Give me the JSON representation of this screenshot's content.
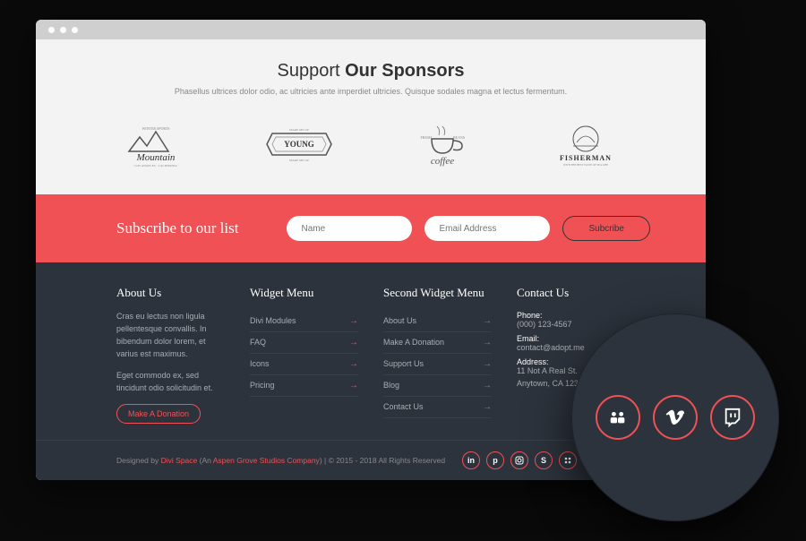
{
  "sponsors": {
    "title_light": "Support ",
    "title_bold": "Our Sponsors",
    "subtitle": "Phasellus ultrices dolor odio, ac ultricies ante imperdiet ultricies. Quisque sodales magna et lectus fermentum.",
    "logos": [
      "Mountain",
      "YOUNG",
      "coffee",
      "FISHERMAN"
    ]
  },
  "subscribe": {
    "heading": "Subscribe to our list",
    "name_placeholder": "Name",
    "email_placeholder": "Email Address",
    "button": "Subcribe"
  },
  "footer": {
    "about": {
      "heading": "About Us",
      "p1": "Cras eu lectus non ligula pellentesque convallis. In bibendum dolor lorem, et varius est maximus.",
      "p2": "Eget commodo ex, sed tincidunt odio solicitudin et.",
      "button": "Make A Donation"
    },
    "menu1": {
      "heading": "Widget Menu",
      "items": [
        "Divi Modules",
        "FAQ",
        "Icons",
        "Pricing"
      ]
    },
    "menu2": {
      "heading": "Second Widget Menu",
      "items": [
        "About Us",
        "Make A Donation",
        "Support Us",
        "Blog",
        "Contact Us"
      ]
    },
    "contact": {
      "heading": "Contact Us",
      "phone_label": "Phone:",
      "phone": "(000) 123-4567",
      "email_label": "Email:",
      "email": "contact@adopt.me",
      "address_label": "Address:",
      "address_line1": "11 Not A Real St.",
      "address_line2": "Anytown, CA 12345"
    }
  },
  "bottom": {
    "designed_by": "Designed by ",
    "link1": "Divi Space",
    "paren_open": " (An ",
    "link2": "Aspen Grove Studios Company",
    "paren_close": ") | © 2015 - 2018 All Rights Reserved",
    "social": [
      "in",
      "p",
      "ig",
      "s",
      "g",
      "v",
      "tw"
    ]
  },
  "zoom_icons": [
    "group-icon",
    "vimeo-icon",
    "twitch-icon"
  ]
}
